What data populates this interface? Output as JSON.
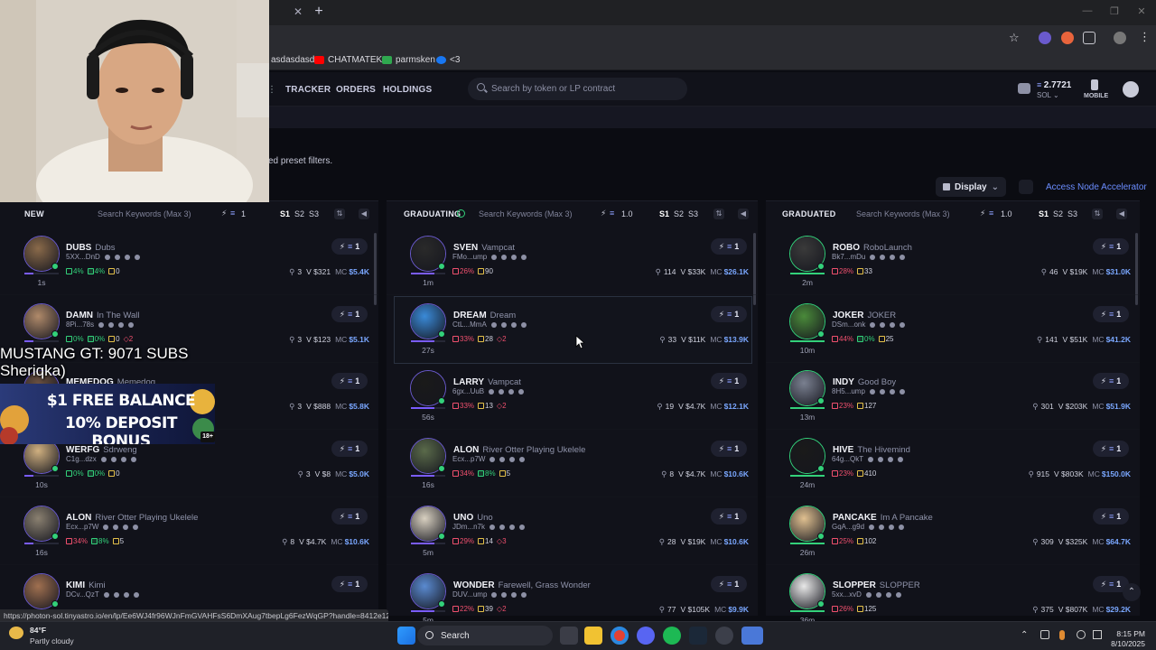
{
  "browser": {
    "bookmarks": [
      "asdasdasd",
      "CHATMATEKO",
      "parmsken",
      "<3"
    ]
  },
  "nav": {
    "links": [
      "TRACKER",
      "ORDERS",
      "HOLDINGS"
    ],
    "search_placeholder": "Search by token or LP contract",
    "wallet_balance": "2.7721",
    "wallet_unit": "SOL",
    "mobile_label": "MOBILE"
  },
  "page": {
    "preset_text": "ed preset filters.",
    "display_label": "Display",
    "accelerator_label": "Access Node Accelerator"
  },
  "columns": [
    {
      "title": "NEW",
      "keywords_placeholder": "Search Keywords (Max 3)",
      "quick_amount": "1",
      "presets": [
        "S1",
        "S2",
        "S3"
      ],
      "cards": [
        {
          "symbol": "DUBS",
          "name": "Dubs",
          "addr": "5XX...DnD",
          "age": "1s",
          "pct1": "4%",
          "pct2": "4%",
          "extra": "0",
          "extra2": "",
          "holders": "3",
          "vol": "V $321",
          "mc": "$5.4K",
          "buy": "1",
          "pct1_color": "green"
        },
        {
          "symbol": "DAMN",
          "name": "In The Wall",
          "addr": "8Pi...78s",
          "age": "",
          "pct1": "0%",
          "pct2": "0%",
          "extra": "0",
          "extra2": "2",
          "holders": "3",
          "vol": "V $123",
          "mc": "$5.1K",
          "buy": "1",
          "pct1_color": "green"
        },
        {
          "symbol": "MEMEDOG",
          "name": "Memedog",
          "addr": "",
          "age": "",
          "pct1": "",
          "pct2": "",
          "extra": "",
          "extra2": "",
          "holders": "3",
          "vol": "V $888",
          "mc": "$5.8K",
          "buy": "1",
          "pct1_color": "green"
        },
        {
          "symbol": "WERFG",
          "name": "Sdrweng",
          "addr": "C1g...dzx",
          "age": "10s",
          "pct1": "0%",
          "pct2": "0%",
          "extra": "0",
          "extra2": "",
          "holders": "3",
          "vol": "V $8",
          "mc": "$5.0K",
          "buy": "1",
          "pct1_color": "green"
        },
        {
          "symbol": "ALON",
          "name": "River Otter Playing Ukelele",
          "addr": "Ecx...p7W",
          "age": "16s",
          "pct1": "34%",
          "pct2": "8%",
          "extra": "5",
          "extra2": "",
          "holders": "8",
          "vol": "V $4.7K",
          "mc": "$10.6K",
          "buy": "1",
          "pct1_color": "red"
        },
        {
          "symbol": "KIMI",
          "name": "Kimi",
          "addr": "DCv...QzT",
          "age": "",
          "pct1": "",
          "pct2": "",
          "extra": "",
          "extra2": "",
          "holders": "",
          "vol": "",
          "mc": "",
          "buy": "1",
          "pct1_color": "green"
        }
      ]
    },
    {
      "title": "GRADUATING",
      "keywords_placeholder": "Search Keywords (Max 3)",
      "quick_amount": "1.0",
      "presets": [
        "S1",
        "S2",
        "S3"
      ],
      "cards": [
        {
          "symbol": "SVEN",
          "name": "Vampcat",
          "addr": "FMo...ump",
          "age": "1m",
          "pct1": "26%",
          "pct2": "",
          "extra": "90",
          "extra2": "",
          "holders": "114",
          "vol": "V $33K",
          "mc": "$26.1K",
          "buy": "1",
          "pct1_color": "red"
        },
        {
          "symbol": "DREAM",
          "name": "Dream",
          "addr": "CtL...MmA",
          "age": "27s",
          "pct1": "33%",
          "pct2": "",
          "extra": "28",
          "extra2": "2",
          "holders": "33",
          "vol": "V $11K",
          "mc": "$13.9K",
          "buy": "1",
          "pct1_color": "red"
        },
        {
          "symbol": "LARRY",
          "name": "Vampcat",
          "addr": "6gx...UuB",
          "age": "56s",
          "pct1": "33%",
          "pct2": "",
          "extra": "13",
          "extra2": "2",
          "holders": "19",
          "vol": "V $4.7K",
          "mc": "$12.1K",
          "buy": "1",
          "pct1_color": "red"
        },
        {
          "symbol": "ALON",
          "name": "River Otter Playing Ukelele",
          "addr": "Ecx...p7W",
          "age": "16s",
          "pct1": "34%",
          "pct2": "8%",
          "extra": "5",
          "extra2": "",
          "holders": "8",
          "vol": "V $4.7K",
          "mc": "$10.6K",
          "buy": "1",
          "pct1_color": "red"
        },
        {
          "symbol": "UNO",
          "name": "Uno",
          "addr": "JDm...n7k",
          "age": "5m",
          "pct1": "29%",
          "pct2": "",
          "extra": "14",
          "extra2": "3",
          "holders": "28",
          "vol": "V $19K",
          "mc": "$10.6K",
          "buy": "1",
          "pct1_color": "red"
        },
        {
          "symbol": "WONDER",
          "name": "Farewell, Grass Wonder",
          "addr": "DUV...ump",
          "age": "5m",
          "pct1": "22%",
          "pct2": "",
          "extra": "39",
          "extra2": "2",
          "holders": "77",
          "vol": "V $105K",
          "mc": "$9.9K",
          "buy": "1",
          "pct1_color": "red"
        }
      ]
    },
    {
      "title": "GRADUATED",
      "keywords_placeholder": "Search Keywords (Max 3)",
      "quick_amount": "1.0",
      "presets": [
        "S1",
        "S2",
        "S3"
      ],
      "cards": [
        {
          "symbol": "ROBO",
          "name": "RoboLaunch",
          "addr": "Bk7...mDu",
          "age": "2m",
          "pct1": "28%",
          "pct2": "",
          "extra": "33",
          "extra2": "",
          "holders": "46",
          "vol": "V $19K",
          "mc": "$31.0K",
          "buy": "1",
          "pct1_color": "red"
        },
        {
          "symbol": "JOKER",
          "name": "JOKER",
          "addr": "DSm...onk",
          "age": "10m",
          "pct1": "44%",
          "pct2": "0%",
          "extra": "25",
          "extra2": "",
          "holders": "141",
          "vol": "V $51K",
          "mc": "$41.2K",
          "buy": "1",
          "pct1_color": "red"
        },
        {
          "symbol": "INDY",
          "name": "Good Boy",
          "addr": "8H5...ump",
          "age": "13m",
          "pct1": "23%",
          "pct2": "",
          "extra": "127",
          "extra2": "",
          "holders": "301",
          "vol": "V $203K",
          "mc": "$51.9K",
          "buy": "1",
          "pct1_color": "red"
        },
        {
          "symbol": "HIVE",
          "name": "The Hivemind",
          "addr": "64g...QkT",
          "age": "24m",
          "pct1": "23%",
          "pct2": "",
          "extra": "410",
          "extra2": "",
          "holders": "915",
          "vol": "V $803K",
          "mc": "$150.0K",
          "buy": "1",
          "pct1_color": "red"
        },
        {
          "symbol": "PANCAKE",
          "name": "Im A Pancake",
          "addr": "GqA...g9d",
          "age": "26m",
          "pct1": "25%",
          "pct2": "",
          "extra": "102",
          "extra2": "",
          "holders": "309",
          "vol": "V $325K",
          "mc": "$64.7K",
          "buy": "1",
          "pct1_color": "red"
        },
        {
          "symbol": "SLOPPER",
          "name": "SLOPPER",
          "addr": "5xx...xvD",
          "age": "36m",
          "pct1": "26%",
          "pct2": "",
          "extra": "125",
          "extra2": "",
          "holders": "375",
          "vol": "V $807K",
          "mc": "$29.2K",
          "buy": "1",
          "pct1_color": "red"
        }
      ]
    }
  ],
  "overlay": {
    "subs_line1": "MUSTANG GT: 9071 SUBS",
    "subs_line2": "Sheriqka)",
    "promo_line1": "$1 FREE BALANCE",
    "promo_line2": "10% DEPOSIT BONUS",
    "promo_badge": "18+"
  },
  "status_url": "https://photon-sol.tinyastro.io/en/lp/Ee6WJ4fr96WJnFmGVAHFsS6DmXAug7tbepLg6FezWqGP?handle=8412e12e862...",
  "taskbar": {
    "weather_temp": "84°F",
    "weather_desc": "Partly cloudy",
    "search_label": "Search",
    "time": "8:15 PM",
    "date": "8/10/2025"
  },
  "colors": {
    "accent_blue": "#7aa7ff",
    "red": "#f0506e",
    "green": "#33d17a",
    "panel": "#11121a"
  }
}
